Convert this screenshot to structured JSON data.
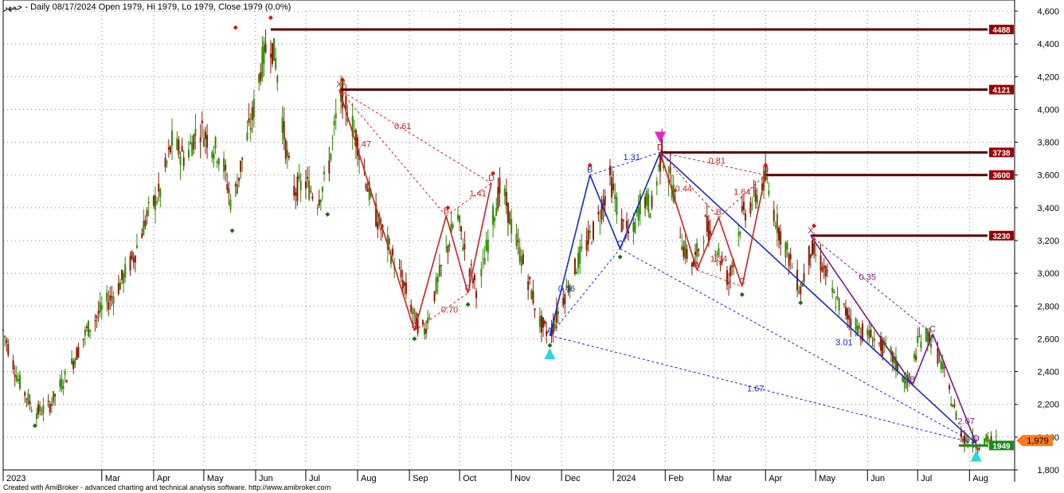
{
  "header": {
    "symbol": "خمهر",
    "text": " - Daily 08/17/2024 Open 1979, Hi 1979, Lo 1979, Close 1979 (0.0%)"
  },
  "footer": {
    "text": "Created with AmiBroker - advanced charting and technical analysis software. http://www.amibroker.com"
  },
  "colors": {
    "candle_up": "#2e8b00",
    "candle_down": "#8b1a00",
    "level_line": "#5c0000",
    "level_box": "#9b0000",
    "pattern_red": "#cc2020",
    "pattern_blue": "#1428c8",
    "pattern_purple": "#7a1a7a",
    "last_price_box": "#ff7a1a",
    "support_box": "#1a8a1a",
    "triangle_up": "#29d6e0",
    "triangle_down": "#ee22cc"
  },
  "chart_data": {
    "type": "candlestick",
    "title": "",
    "xlabel": "",
    "ylabel": "",
    "ylim": [
      1800,
      4600
    ],
    "date_range": [
      "2023-01-01",
      "2024-08-28"
    ],
    "y_ticks": [
      {
        "value": 1800,
        "label": "1,800"
      },
      {
        "value": 2000,
        "label": "2,000"
      },
      {
        "value": 2200,
        "label": "2,200"
      },
      {
        "value": 2400,
        "label": "2,400"
      },
      {
        "value": 2600,
        "label": "2,600"
      },
      {
        "value": 2800,
        "label": "2,800"
      },
      {
        "value": 3000,
        "label": "3,000"
      },
      {
        "value": 3200,
        "label": "3,200"
      },
      {
        "value": 3400,
        "label": "3,400"
      },
      {
        "value": 3600,
        "label": "3,600"
      },
      {
        "value": 3800,
        "label": "3,800"
      },
      {
        "value": 4000,
        "label": "4,000"
      },
      {
        "value": 4200,
        "label": "4,200"
      },
      {
        "value": 4400,
        "label": "4,400"
      },
      {
        "value": 4600,
        "label": "4,600"
      }
    ],
    "x_ticks": [
      {
        "date": "2023-01-01",
        "label": "2023"
      },
      {
        "date": "2023-03-01",
        "label": "Mar"
      },
      {
        "date": "2023-04-01",
        "label": "Apr"
      },
      {
        "date": "2023-05-01",
        "label": "May"
      },
      {
        "date": "2023-06-01",
        "label": "Jun"
      },
      {
        "date": "2023-07-01",
        "label": "Jul"
      },
      {
        "date": "2023-08-01",
        "label": "Aug"
      },
      {
        "date": "2023-09-01",
        "label": "Sep"
      },
      {
        "date": "2023-10-01",
        "label": "Oct"
      },
      {
        "date": "2023-11-01",
        "label": "Nov"
      },
      {
        "date": "2023-12-01",
        "label": "Dec"
      },
      {
        "date": "2024-01-01",
        "label": "2024"
      },
      {
        "date": "2024-02-01",
        "label": "Feb"
      },
      {
        "date": "2024-03-01",
        "label": "Mar"
      },
      {
        "date": "2024-04-01",
        "label": "Apr"
      },
      {
        "date": "2024-05-01",
        "label": "May"
      },
      {
        "date": "2024-06-01",
        "label": "Jun"
      },
      {
        "date": "2024-07-01",
        "label": "Jul"
      },
      {
        "date": "2024-08-01",
        "label": "Aug"
      }
    ],
    "price_path": [
      [
        "2023-01-01",
        2650
      ],
      [
        "2023-01-10",
        2350
      ],
      [
        "2023-01-20",
        2150
      ],
      [
        "2023-01-28",
        2180
      ],
      [
        "2023-02-10",
        2420
      ],
      [
        "2023-02-20",
        2650
      ],
      [
        "2023-03-01",
        2780
      ],
      [
        "2023-03-10",
        2900
      ],
      [
        "2023-03-20",
        3100
      ],
      [
        "2023-03-28",
        3350
      ],
      [
        "2023-04-05",
        3500
      ],
      [
        "2023-04-12",
        3800
      ],
      [
        "2023-04-20",
        3700
      ],
      [
        "2023-04-28",
        3900
      ],
      [
        "2023-05-05",
        3800
      ],
      [
        "2023-05-12",
        3700
      ],
      [
        "2023-05-18",
        3400
      ],
      [
        "2023-05-24",
        3700
      ],
      [
        "2023-05-30",
        3950
      ],
      [
        "2023-06-04",
        4250
      ],
      [
        "2023-06-09",
        4450
      ],
      [
        "2023-06-13",
        4300
      ],
      [
        "2023-06-18",
        3850
      ],
      [
        "2023-06-23",
        3500
      ],
      [
        "2023-07-01",
        3550
      ],
      [
        "2023-07-08",
        3450
      ],
      [
        "2023-07-14",
        3600
      ],
      [
        "2023-07-20",
        4000
      ],
      [
        "2023-07-23",
        4100
      ],
      [
        "2023-08-01",
        3800
      ],
      [
        "2023-08-10",
        3400
      ],
      [
        "2023-08-20",
        3150
      ],
      [
        "2023-08-28",
        2950
      ],
      [
        "2023-09-05",
        2700
      ],
      [
        "2023-09-10",
        2650
      ],
      [
        "2023-09-18",
        2950
      ],
      [
        "2023-09-25",
        3200
      ],
      [
        "2023-09-29",
        3380
      ],
      [
        "2023-10-05",
        3100
      ],
      [
        "2023-10-12",
        2880
      ],
      [
        "2023-10-20",
        3300
      ],
      [
        "2023-10-26",
        3550
      ],
      [
        "2023-11-02",
        3250
      ],
      [
        "2023-11-10",
        3000
      ],
      [
        "2023-11-18",
        2700
      ],
      [
        "2023-11-24",
        2620
      ],
      [
        "2023-12-02",
        2850
      ],
      [
        "2023-12-12",
        3100
      ],
      [
        "2023-12-22",
        3300
      ],
      [
        "2023-12-30",
        3580
      ],
      [
        "2024-01-06",
        3300
      ],
      [
        "2024-01-12",
        3200
      ],
      [
        "2024-01-18",
        3480
      ],
      [
        "2024-01-24",
        3400
      ],
      [
        "2024-01-30",
        3750
      ],
      [
        "2024-02-06",
        3500
      ],
      [
        "2024-02-12",
        3150
      ],
      [
        "2024-02-18",
        3050
      ],
      [
        "2024-02-25",
        3300
      ],
      [
        "2024-03-03",
        3150
      ],
      [
        "2024-03-10",
        2950
      ],
      [
        "2024-03-18",
        3350
      ],
      [
        "2024-03-25",
        3450
      ],
      [
        "2024-04-01",
        3580
      ],
      [
        "2024-04-08",
        3300
      ],
      [
        "2024-04-15",
        3100
      ],
      [
        "2024-04-22",
        2900
      ],
      [
        "2024-04-28",
        3150
      ],
      [
        "2024-05-05",
        3050
      ],
      [
        "2024-05-12",
        2850
      ],
      [
        "2024-05-20",
        2750
      ],
      [
        "2024-05-28",
        2650
      ],
      [
        "2024-06-05",
        2600
      ],
      [
        "2024-06-15",
        2500
      ],
      [
        "2024-06-25",
        2320
      ],
      [
        "2024-07-02",
        2600
      ],
      [
        "2024-07-08",
        2620
      ],
      [
        "2024-07-15",
        2450
      ],
      [
        "2024-07-22",
        2200
      ],
      [
        "2024-07-28",
        2000
      ],
      [
        "2024-08-05",
        1960
      ],
      [
        "2024-08-12",
        1979
      ],
      [
        "2024-08-17",
        1979
      ]
    ],
    "levels": [
      {
        "value": 4488,
        "label": "4488",
        "from": "2023-06-10"
      },
      {
        "value": 4121,
        "label": "4121",
        "from": "2023-07-22"
      },
      {
        "value": 3738,
        "label": "3738",
        "from": "2024-01-29"
      },
      {
        "value": 3600,
        "label": "3600",
        "from": "2024-04-01"
      },
      {
        "value": 3230,
        "label": "3230",
        "from": "2024-04-28"
      }
    ],
    "last_price": {
      "value": 1979,
      "label": "1,979"
    },
    "support": {
      "value": 1949,
      "label": "1949"
    },
    "patterns": [
      {
        "name": "pattern-1",
        "color": "pattern_red",
        "points": [
          {
            "label": "X",
            "date": "2023-07-21",
            "value": 4121
          },
          {
            "label": "A",
            "date": "2023-09-04",
            "value": 2650
          },
          {
            "label": "B",
            "date": "2023-09-23",
            "value": 3350
          },
          {
            "label": "C",
            "date": "2023-10-06",
            "value": 2880
          },
          {
            "label": "D",
            "date": "2023-10-20",
            "value": 3550
          }
        ],
        "ratios": [
          {
            "label": "0.61",
            "date": "2023-08-28",
            "value": 3880
          },
          {
            "label": "0.47",
            "date": "2023-08-04",
            "value": 3770
          },
          {
            "label": "1.41",
            "date": "2023-10-12",
            "value": 3470
          },
          {
            "label": "0.70",
            "date": "2023-09-25",
            "value": 2760
          }
        ]
      },
      {
        "name": "pattern-2",
        "color": "pattern_blue",
        "points": [
          {
            "label": "A",
            "date": "2023-11-24",
            "value": 2620
          },
          {
            "label": "B",
            "date": "2023-12-18",
            "value": 3600
          },
          {
            "label": "C",
            "date": "2024-01-05",
            "value": 3150
          },
          {
            "label": "D",
            "date": "2024-01-29",
            "value": 3738
          },
          {
            "label": "D",
            "date": "2024-08-05",
            "value": 1960
          }
        ],
        "ratios": [
          {
            "label": "1.31",
            "date": "2024-01-12",
            "value": 3690
          },
          {
            "label": "0.46",
            "date": "2023-12-04",
            "value": 2890
          },
          {
            "label": "3.01",
            "date": "2024-05-18",
            "value": 2560
          },
          {
            "label": "1.67",
            "date": "2024-03-26",
            "value": 2280
          }
        ]
      },
      {
        "name": "pattern-3",
        "color": "pattern_red",
        "points": [
          {
            "label": "D",
            "date": "2024-01-29",
            "value": 3738
          },
          {
            "label": "A",
            "date": "2024-02-20",
            "value": 3020
          },
          {
            "label": "B",
            "date": "2024-03-04",
            "value": 3340
          },
          {
            "label": "C",
            "date": "2024-03-18",
            "value": 2920
          },
          {
            "label": "D",
            "date": "2024-04-01",
            "value": 3600
          }
        ],
        "ratios": [
          {
            "label": "0.81",
            "date": "2024-03-03",
            "value": 3670
          },
          {
            "label": "0.44",
            "date": "2024-02-12",
            "value": 3500
          },
          {
            "label": "1.64",
            "date": "2024-03-18",
            "value": 3480
          },
          {
            "label": "1.34",
            "date": "2024-03-04",
            "value": 3070
          }
        ]
      },
      {
        "name": "pattern-4",
        "color": "pattern_purple",
        "points": [
          {
            "label": "X",
            "date": "2024-04-28",
            "value": 3230
          },
          {
            "label": "B",
            "date": "2024-06-28",
            "value": 2320
          },
          {
            "label": "C",
            "date": "2024-07-10",
            "value": 2630
          },
          {
            "label": "D",
            "date": "2024-08-05",
            "value": 1960
          }
        ],
        "ratios": [
          {
            "label": "0.35",
            "date": "2024-06-01",
            "value": 2960
          },
          {
            "label": "2.07",
            "date": "2024-07-30",
            "value": 2080
          }
        ]
      }
    ],
    "pivot_markers": [
      {
        "kind": "high",
        "date": "2023-05-20",
        "value": 4500
      },
      {
        "kind": "high",
        "date": "2023-06-10",
        "value": 4560
      },
      {
        "kind": "high",
        "date": "2023-07-23",
        "value": 4180
      },
      {
        "kind": "high",
        "date": "2023-09-24",
        "value": 3400
      },
      {
        "kind": "high",
        "date": "2023-10-21",
        "value": 3610
      },
      {
        "kind": "high",
        "date": "2023-12-18",
        "value": 3660
      },
      {
        "kind": "high",
        "date": "2024-04-01",
        "value": 3660
      },
      {
        "kind": "high",
        "date": "2024-04-30",
        "value": 3290
      },
      {
        "kind": "low",
        "date": "2023-01-20",
        "value": 2070
      },
      {
        "kind": "low",
        "date": "2023-05-18",
        "value": 3260
      },
      {
        "kind": "low",
        "date": "2023-07-14",
        "value": 3360
      },
      {
        "kind": "low",
        "date": "2023-09-04",
        "value": 2600
      },
      {
        "kind": "low",
        "date": "2023-10-06",
        "value": 2810
      },
      {
        "kind": "low",
        "date": "2023-11-24",
        "value": 2560
      },
      {
        "kind": "low",
        "date": "2024-01-05",
        "value": 3100
      },
      {
        "kind": "low",
        "date": "2024-03-18",
        "value": 2870
      },
      {
        "kind": "low",
        "date": "2024-04-22",
        "value": 2820
      }
    ],
    "triangles": [
      {
        "kind": "up",
        "date": "2023-11-24",
        "value": 2510
      },
      {
        "kind": "down",
        "date": "2024-01-29",
        "value": 3830
      },
      {
        "kind": "up",
        "date": "2024-08-05",
        "value": 1885
      }
    ]
  }
}
